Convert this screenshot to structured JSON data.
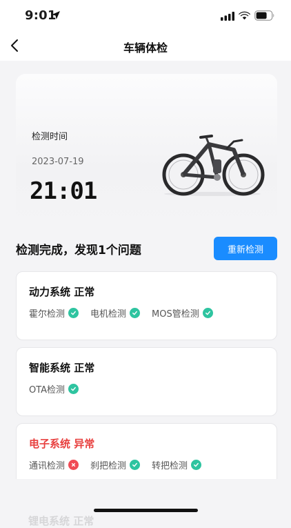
{
  "status_bar": {
    "time": "9:01"
  },
  "nav": {
    "title": "车辆体检"
  },
  "hero": {
    "label": "检测时间",
    "date": "2023-07-19",
    "time": "21:01"
  },
  "summary": {
    "text": "检测完成，发现1个问题",
    "recheck_label": "重新检测"
  },
  "systems": [
    {
      "title": "动力系统 正常",
      "status": "normal",
      "checks": [
        {
          "label": "霍尔检测",
          "ok": true
        },
        {
          "label": "电机检测",
          "ok": true
        },
        {
          "label": "MOS管检测",
          "ok": true
        }
      ]
    },
    {
      "title": "智能系统 正常",
      "status": "normal",
      "checks": [
        {
          "label": "OTA检测",
          "ok": true
        }
      ]
    },
    {
      "title": "电子系统 异常",
      "status": "error",
      "checks": [
        {
          "label": "通讯检测",
          "ok": false
        },
        {
          "label": "刹把检测",
          "ok": true
        },
        {
          "label": "转把检测",
          "ok": true
        }
      ]
    }
  ],
  "next_card_peek": "锂电系统 正常",
  "colors": {
    "accent": "#1a8cff",
    "ok": "#2ec4a0",
    "fail": "#f04b55",
    "error_text": "#e8403f"
  }
}
